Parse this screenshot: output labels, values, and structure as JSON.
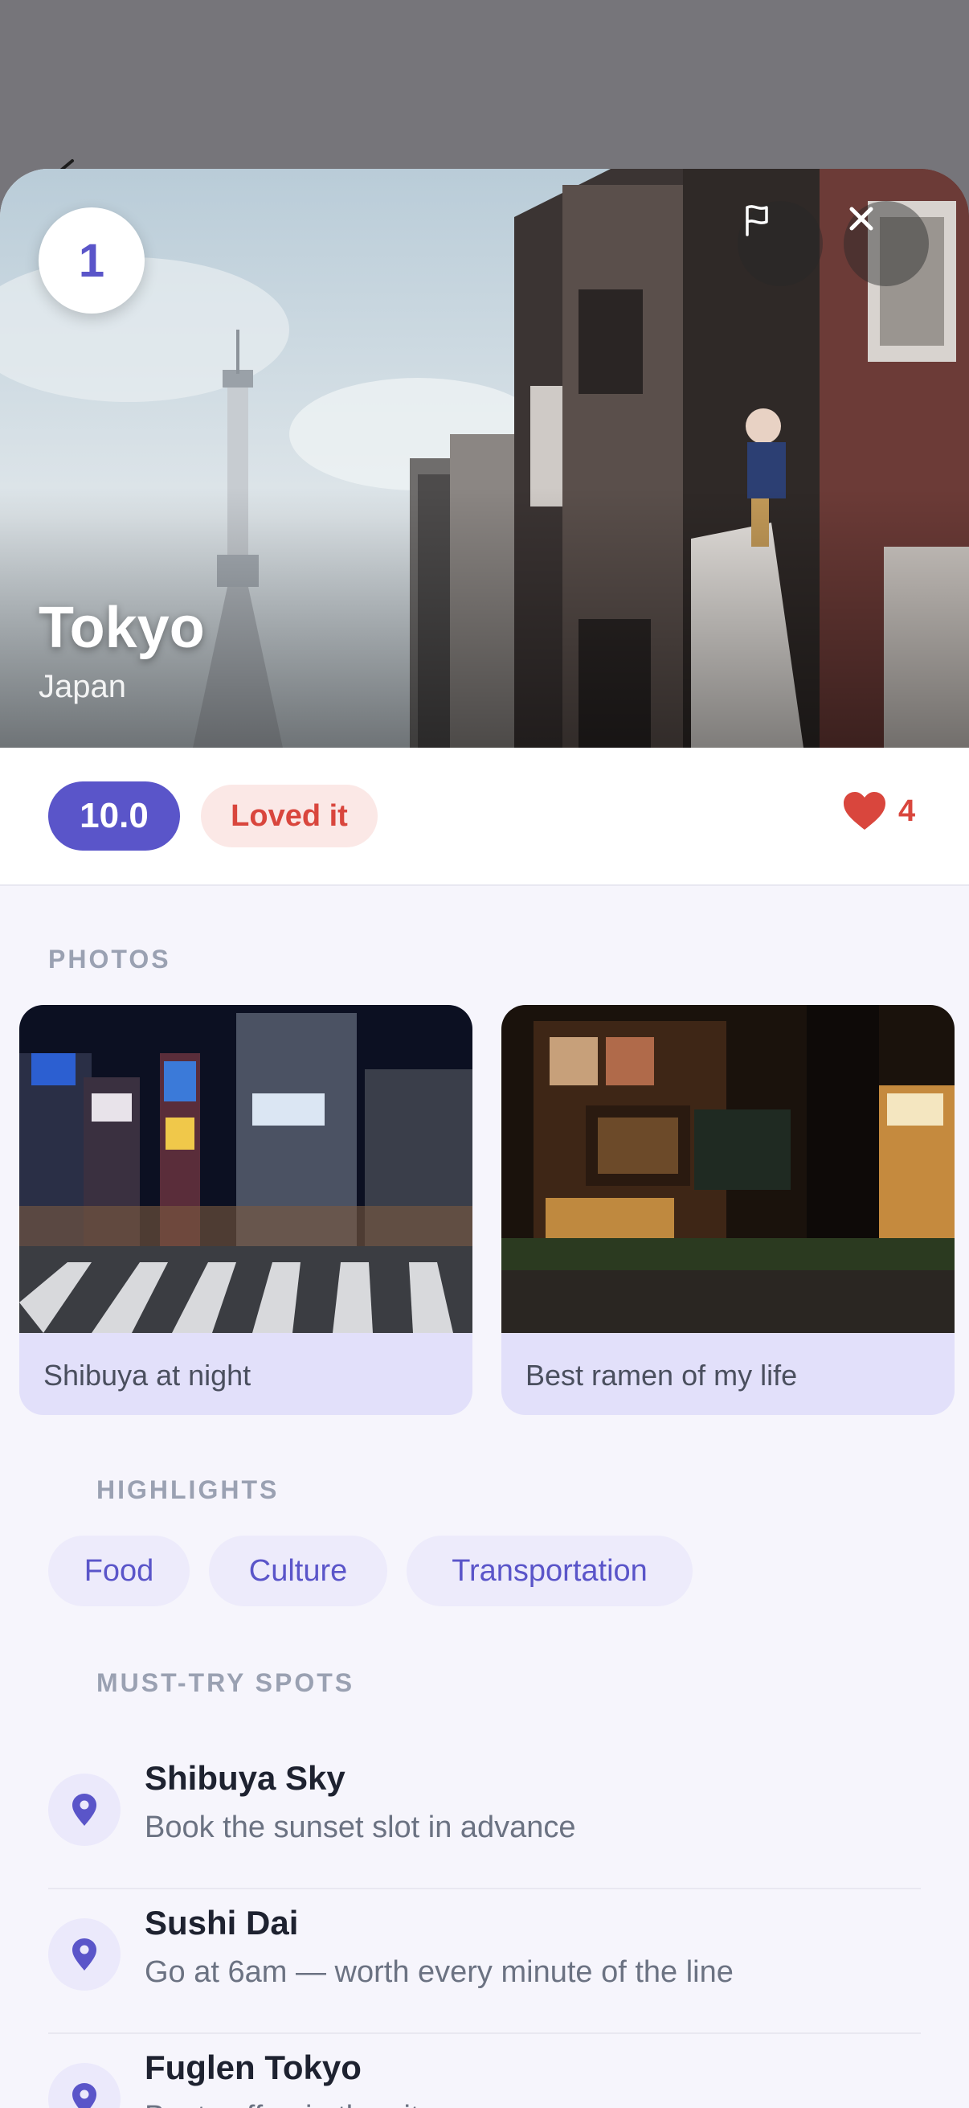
{
  "card": {
    "rank": "1",
    "city": "Tokyo",
    "country": "Japan",
    "score": "10.0",
    "verdict": "Loved it",
    "likes": "4"
  },
  "sections": {
    "photos": "PHOTOS",
    "highlights": "HIGHLIGHTS",
    "spots": "MUST-TRY SPOTS"
  },
  "photos": [
    {
      "caption": "Shibuya at night"
    },
    {
      "caption": "Best ramen of my life"
    }
  ],
  "highlights": [
    "Food",
    "Culture",
    "Transportation"
  ],
  "spots": [
    {
      "name": "Shibuya Sky",
      "note": "Book the sunset slot in advance"
    },
    {
      "name": "Sushi Dai",
      "note": "Go at 6am — worth every minute of the line"
    },
    {
      "name": "Fuglen Tokyo",
      "note": "Best coffee in the city"
    }
  ],
  "colors": {
    "accent": "#5a55c9",
    "love": "#d9463d",
    "sheet_bg": "#f6f5fc"
  },
  "icons": {
    "flag": "flag-icon",
    "close": "close-icon",
    "heart": "heart-icon",
    "pin": "map-pin-icon",
    "back": "back-arrow-icon"
  }
}
